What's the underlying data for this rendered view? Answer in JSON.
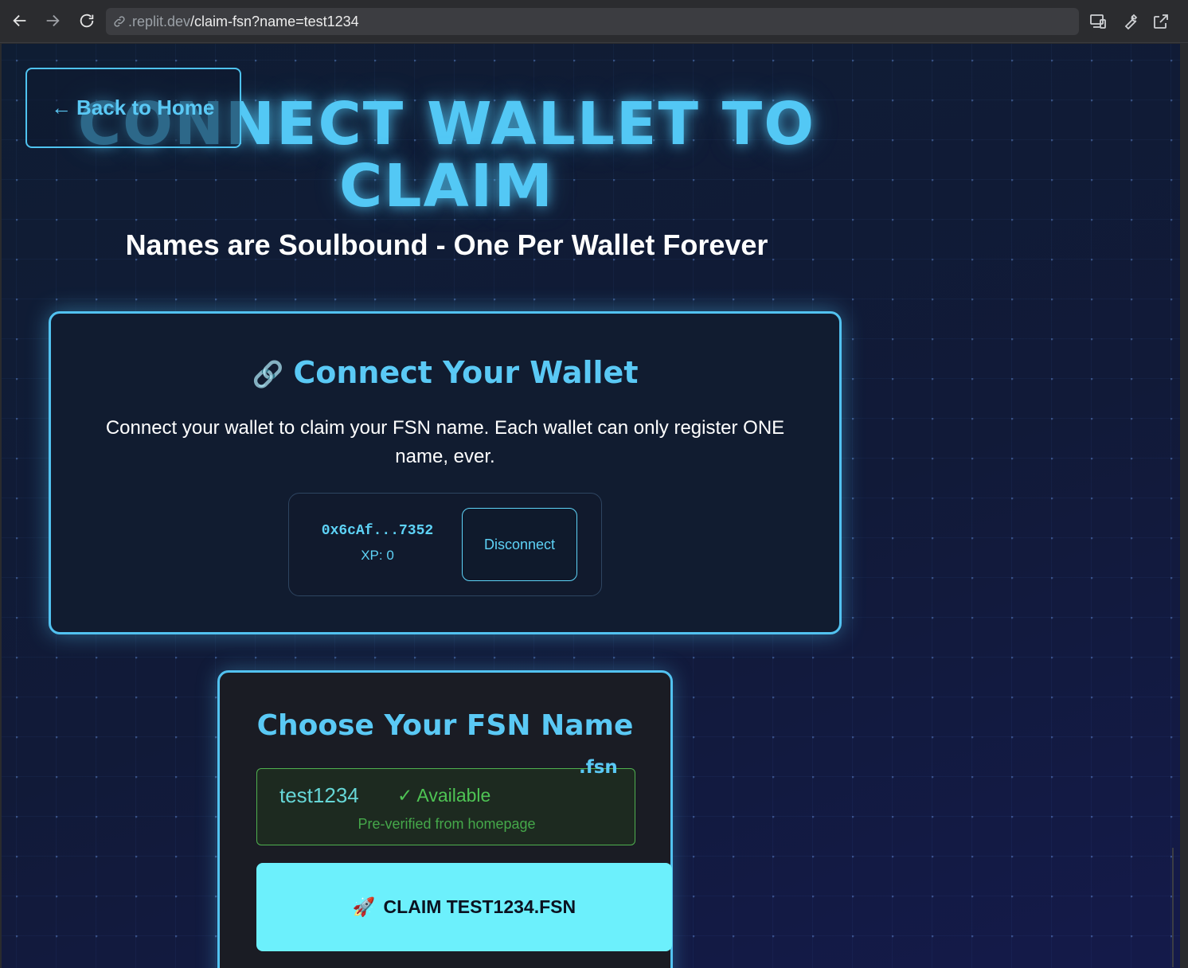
{
  "browser": {
    "url_domain": ".replit.dev",
    "url_path": "/claim-fsn?name=test1234"
  },
  "hero": {
    "title": "CONNECT WALLET TO CLAIM",
    "subtitle": "Names are Soulbound - One Per Wallet Forever"
  },
  "back_button": {
    "arrow": "←",
    "label": "Back to Home"
  },
  "connect_card": {
    "icon": "link-icon",
    "glyph": "🔗",
    "heading": "Connect Your Wallet",
    "description": "Connect your wallet to claim your FSN name. Each wallet can only register ONE name, ever.",
    "wallet_address": "0x6cAf...7352",
    "xp_label": "XP: 0",
    "disconnect_label": "Disconnect"
  },
  "claim_card": {
    "heading": "Choose Your FSN Name",
    "name_value": "test1234",
    "availability": "✓ Available",
    "preverified_note": "Pre-verified from homepage",
    "suffix": ".fsn",
    "claim_icon": "🚀",
    "claim_label": "CLAIM TEST1234.FSN"
  },
  "colors": {
    "accent": "#5ac9f5",
    "page_bg": "#0f1a30",
    "available_green": "#4ec454",
    "claim_button": "#6cf0fc"
  }
}
